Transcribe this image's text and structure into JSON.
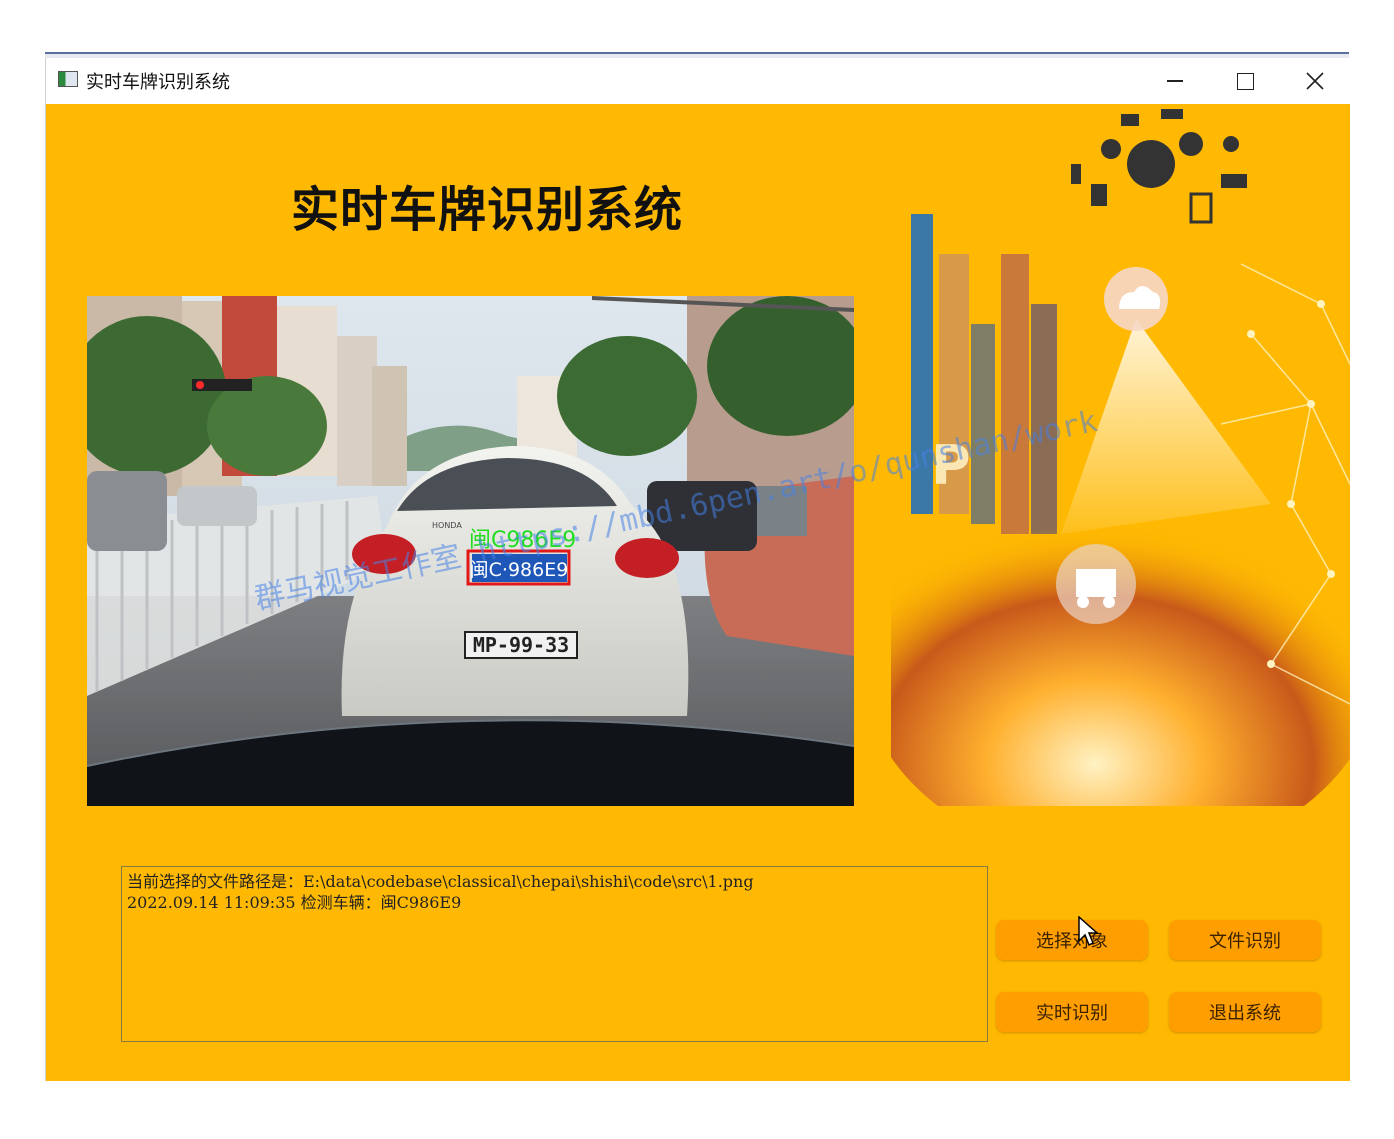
{
  "window": {
    "title": "实时车牌识别系统",
    "controls": {
      "minimize": "minimize",
      "maximize": "maximize",
      "close": "close"
    }
  },
  "app": {
    "heading": "实时车牌识别系统"
  },
  "image": {
    "detected_text": "闽C986E9",
    "plate_text": "闽C·986E9",
    "rear_plate_text": "MP-99-33",
    "car_badge": "HONDA"
  },
  "watermark": "群马视觉工作室 https://mbd.6pen.art/o/qunshan/work",
  "log": {
    "lines": [
      "当前选择的文件路径是：E:\\data\\codebase\\classical\\chepai\\shishi\\code\\src\\1.png",
      "2022.09.14 11:09:35 检测车辆：闽C986E9"
    ]
  },
  "buttons": {
    "select_target": "选择对象",
    "file_recognition": "文件识别",
    "realtime_recognition": "实时识别",
    "exit_system": "退出系统"
  },
  "colors": {
    "client_bg": "#ffb902",
    "button_bg": "#ff9e00",
    "detect_box": "#e01818",
    "detect_text": "#22dd22"
  },
  "icons": [
    "app-window-icon",
    "minimize-icon",
    "maximize-icon",
    "close-icon",
    "mouse-cursor-icon"
  ]
}
